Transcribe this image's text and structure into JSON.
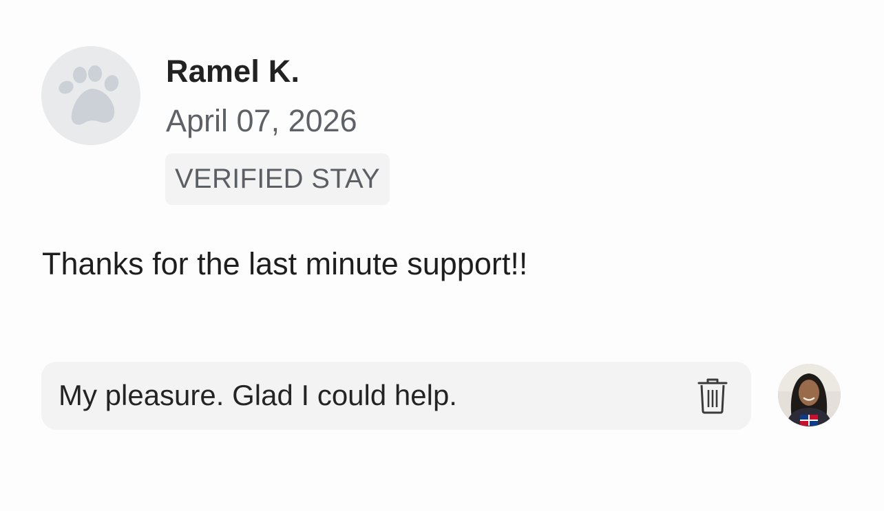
{
  "review": {
    "reviewer_avatar_icon": "paw-icon",
    "reviewer_name": "Ramel K.",
    "date": "April 07, 2026",
    "badge": "VERIFIED STAY",
    "text": "Thanks for the last minute support!!"
  },
  "reply": {
    "text": "My pleasure. Glad I could help.",
    "delete_icon": "trash-icon",
    "host_avatar": "host-avatar-photo"
  },
  "colors": {
    "background": "#fdfdfd",
    "avatar_placeholder": "#e9eaec",
    "paw": "#ccd1d8",
    "badge_bg": "#f3f3f3",
    "bubble_bg": "#f3f3f3",
    "secondary_text": "#5e6166",
    "primary_text": "#222222"
  }
}
